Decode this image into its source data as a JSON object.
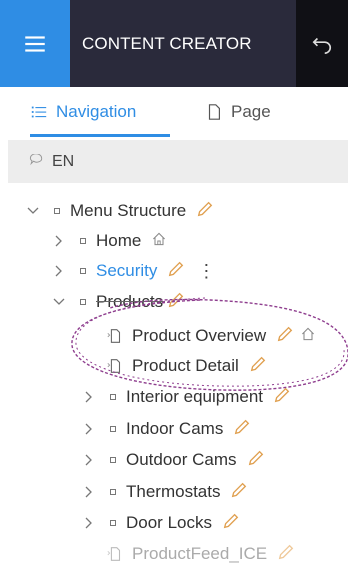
{
  "header": {
    "title": "CONTENT CREATOR",
    "menu_icon": "hamburger-icon",
    "undo_icon": "undo-icon",
    "accent": "#2f8de4",
    "dark": "#2a2a3b"
  },
  "tabs": [
    {
      "label": "Navigation",
      "icon": "list-icon",
      "active": true
    },
    {
      "label": "Page",
      "icon": "document-icon",
      "active": false
    }
  ],
  "language": {
    "label": "EN",
    "icon": "speech-bubble-icon"
  },
  "tree": {
    "root": {
      "label": "Menu Structure"
    },
    "home": {
      "label": "Home"
    },
    "security": {
      "label": "Security",
      "kebab": "⋮"
    },
    "products": {
      "label": "Products"
    },
    "product_overview": {
      "label": "Product Overview"
    },
    "product_detail": {
      "label": "Product Detail"
    },
    "interior": {
      "label": "Interior equipment"
    },
    "indoor": {
      "label": "Indoor Cams"
    },
    "outdoor": {
      "label": "Outdoor Cams"
    },
    "thermostats": {
      "label": "Thermostats"
    },
    "doorlocks": {
      "label": "Door Locks"
    },
    "productfeed": {
      "label": "ProductFeed_ICE"
    }
  },
  "annotation_color": "#8e3d8e"
}
